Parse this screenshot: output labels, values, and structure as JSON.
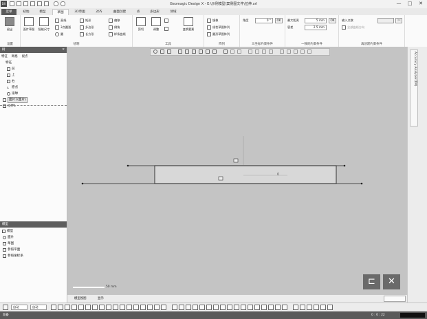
{
  "app": {
    "title": "Geomagic Design X - E:\\示例模型\\案例图文件\\拉伸.xrl",
    "logo": "DX",
    "window_buttons": [
      "—",
      "□",
      "✕"
    ]
  },
  "tabs": [
    {
      "label": "菜单",
      "file": true
    },
    {
      "label": "初始"
    },
    {
      "label": "模型"
    },
    {
      "label": "草图",
      "active": true
    },
    {
      "label": "3D草图"
    },
    {
      "label": "对齐"
    },
    {
      "label": "曲面创建"
    },
    {
      "label": "点"
    },
    {
      "label": "多边形"
    },
    {
      "label": "领域"
    }
  ],
  "ribbon": {
    "groups": {
      "settings": "设置",
      "draw": "绘制",
      "tools": "工具",
      "array": "阵列",
      "three_point_circle": "三坐标约束条件",
      "common_constraint": "一致的约束条件",
      "offset_constraint": "再创建约束条件"
    },
    "buttons": {
      "exit": "退出",
      "face_sketch": "面片草图",
      "smart_dim": "智能尺寸",
      "line": "直线",
      "rect": "矩形",
      "circle": "圆",
      "arc": "3点圆弧",
      "spline": "样条曲线",
      "polygon": "多边形",
      "offset": "偏移",
      "trim": "剪切",
      "adjust": "调整",
      "convert": "变换要素",
      "mirror": "镜像",
      "linear_array": "线性草图阵列",
      "circular_array": "圆形草图阵列",
      "mirror2": "翻转",
      "fillet": "倒角",
      "slot": "长方形"
    },
    "fields": {
      "angle_label": "角度",
      "angle_value": "0 °",
      "min_size_label": "最大距离",
      "min_size_value": "5 mm",
      "tol_label": "容差",
      "tol_value": "2.5 mm",
      "input_points_label": "输入点数",
      "all_label": "全部曲线方向",
      "ok": "OK"
    }
  },
  "left_panel": {
    "tree_title": "树",
    "tabs": [
      "特征",
      "网格",
      "视点"
    ],
    "feature_header": "特征",
    "features": [
      {
        "label": "前"
      },
      {
        "label": "上"
      },
      {
        "label": "右"
      },
      {
        "label": "原点"
      },
      {
        "label": "滚球"
      },
      {
        "label": "面片1(面片)"
      },
      {
        "label": "拉伸1"
      }
    ],
    "model_title": "模型",
    "model_header": "模型",
    "model_items": [
      {
        "label": "面片"
      },
      {
        "label": "草图"
      },
      {
        "label": "参照平面"
      },
      {
        "label": "参照坐标系"
      }
    ]
  },
  "viewport": {
    "dim_label": "0",
    "scale_label": "50 mm"
  },
  "right_panel": {
    "tab": "Accuracy Analyzer(TM)"
  },
  "bottom_tabs": [
    "模型视图",
    "显示"
  ],
  "bottom_toolbar": {
    "select_mode": "自动",
    "filter": "自动"
  },
  "status": {
    "left": "准备",
    "right": "0 : 0 : 22"
  },
  "overlay": {
    "confirm": "⊏",
    "cancel": "✕"
  }
}
